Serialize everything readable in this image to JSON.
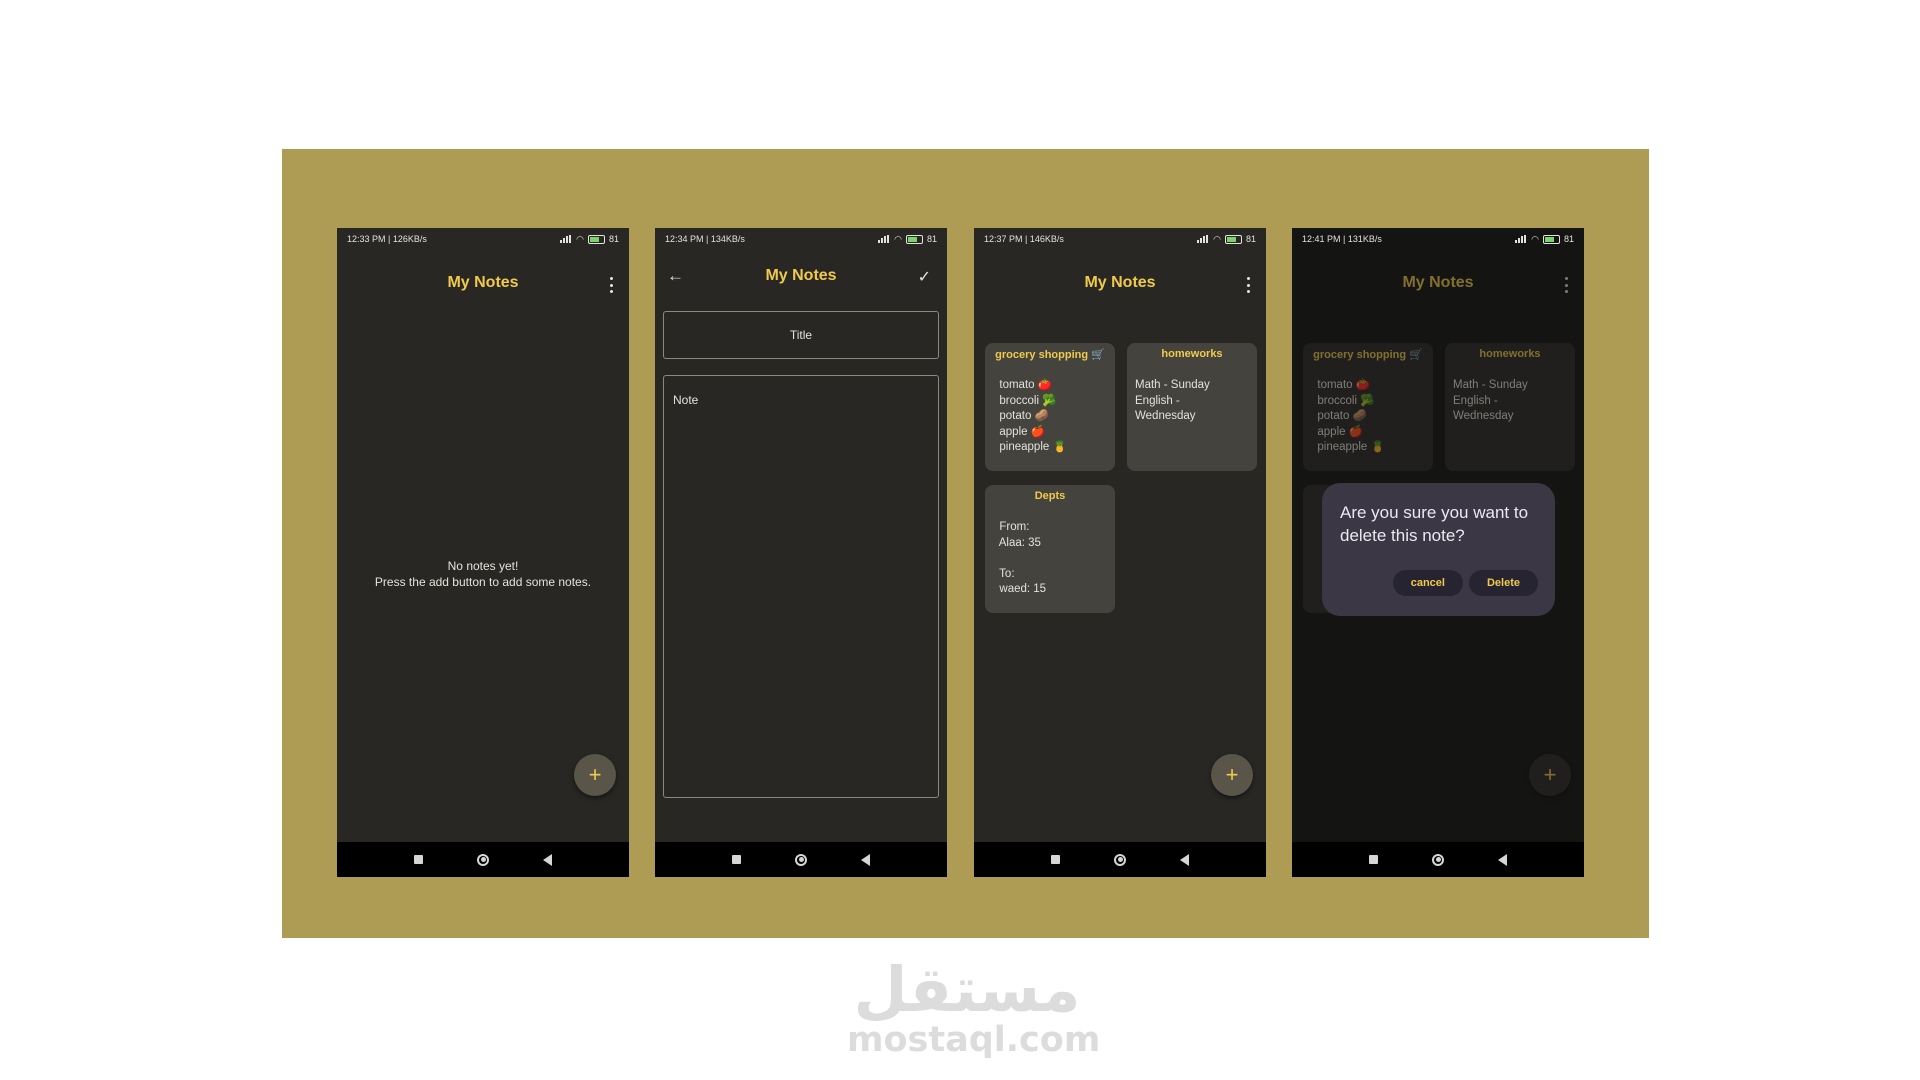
{
  "colors": {
    "panel": "#ae9b54",
    "screen": "#282724",
    "accent": "#f1ca4c",
    "card": "#45433d",
    "dialog": "#3b3744"
  },
  "phones": [
    {
      "status": {
        "time": "12:33 PM | 126KB/s",
        "battery": "81"
      },
      "title": "My Notes",
      "empty_line1": "No notes yet!",
      "empty_line2": "Press the add button to add some notes.",
      "fab": "+"
    },
    {
      "status": {
        "time": "12:34 PM | 134KB/s",
        "battery": "81"
      },
      "title": "My Notes",
      "back_icon": "←",
      "save_icon": "✓",
      "title_placeholder": "Title",
      "note_placeholder": "Note"
    },
    {
      "status": {
        "time": "12:37 PM | 146KB/s",
        "battery": "81"
      },
      "title": "My Notes",
      "fab": "+",
      "notes": [
        {
          "title": "grocery shopping 🛒",
          "body": "  tomato 🍅\n  broccoli 🥦\n  potato 🥔\n  apple 🍎\n  pineapple 🍍"
        },
        {
          "title": "homeworks",
          "body": "Math - Sunday\nEnglish -\nWednesday"
        },
        {
          "title": "Depts",
          "body": "  From:\n  Alaa: 35\n\n  To:\n  waed: 15"
        }
      ]
    },
    {
      "status": {
        "time": "12:41 PM | 131KB/s",
        "battery": "81"
      },
      "title": "My Notes",
      "fab": "+",
      "notes": [
        {
          "title": "grocery shopping 🛒",
          "body": "  tomato 🍅\n  broccoli 🥦\n  potato 🥔\n  apple 🍎\n  pineapple 🍍"
        },
        {
          "title": "homeworks",
          "body": "Math - Sunday\nEnglish -\nWednesday"
        }
      ],
      "dialog": {
        "message": "Are you sure you want to delete this note?",
        "cancel": "cancel",
        "delete": "Delete"
      }
    }
  ],
  "watermark": {
    "logo": "مستقل",
    "url": "mostaql.com"
  }
}
